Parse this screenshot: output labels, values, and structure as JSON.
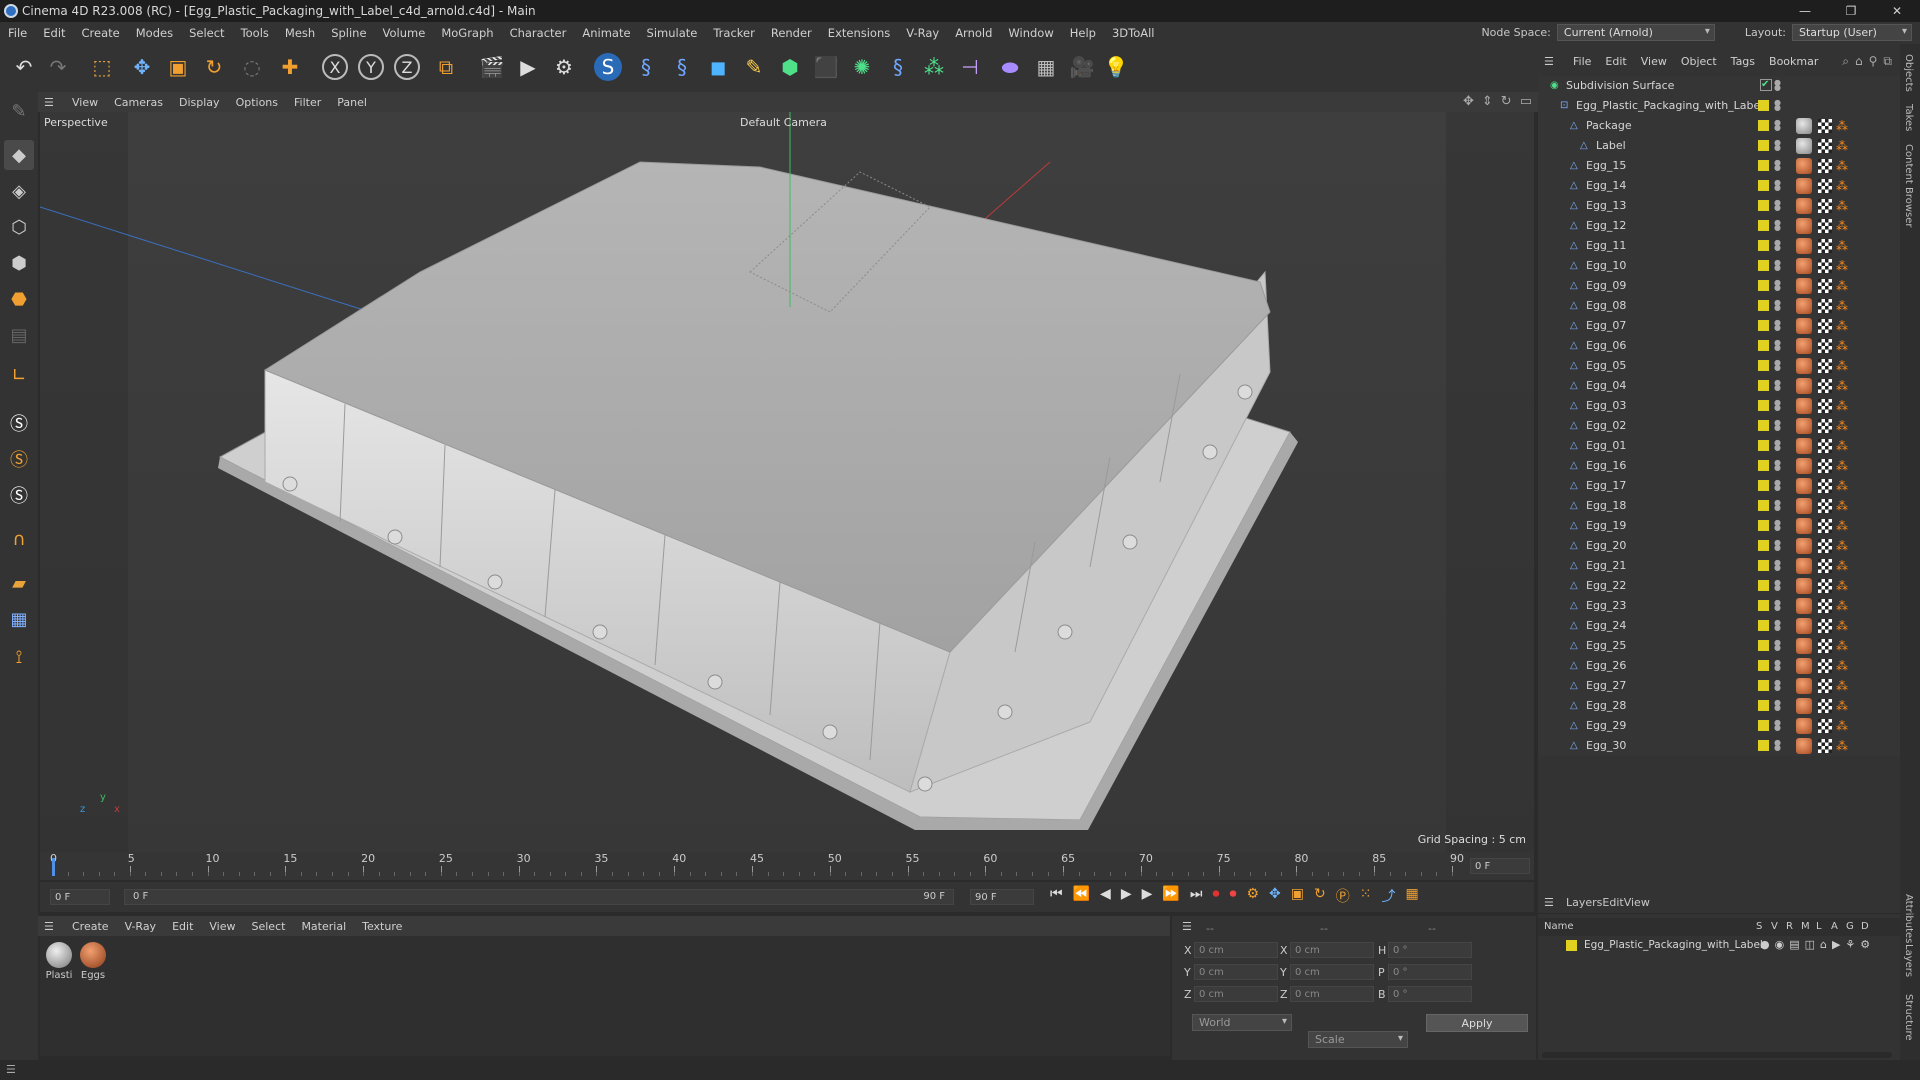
{
  "window": {
    "title": "Cinema 4D R23.008 (RC) - [Egg_Plastic_Packaging_with_Label_c4d_arnold.c4d] - Main",
    "min": "—",
    "max": "❐",
    "close": "✕"
  },
  "menubar": {
    "items": [
      "File",
      "Edit",
      "Create",
      "Modes",
      "Select",
      "Tools",
      "Mesh",
      "Spline",
      "Volume",
      "MoGraph",
      "Character",
      "Animate",
      "Simulate",
      "Tracker",
      "Render",
      "Extensions",
      "V-Ray",
      "Arnold",
      "Window",
      "Help",
      "3DToAll"
    ],
    "node_space_label": "Node Space:",
    "node_space_value": "Current (Arnold)",
    "layout_label": "Layout:",
    "layout_value": "Startup (User)"
  },
  "viewport": {
    "menu": [
      "View",
      "Cameras",
      "Display",
      "Options",
      "Filter",
      "Panel"
    ],
    "label": "Perspective",
    "camera": "Default Camera",
    "grid_spacing": "Grid Spacing : 5 cm"
  },
  "timeline": {
    "ticks": [
      "0",
      "5",
      "10",
      "15",
      "20",
      "25",
      "30",
      "35",
      "40",
      "45",
      "50",
      "55",
      "60",
      "65",
      "70",
      "75",
      "80",
      "85",
      "90"
    ],
    "end_field": "0 F"
  },
  "playback": {
    "current": "0 F",
    "range_start": "0 F",
    "range_end": "90 F",
    "max": "90 F"
  },
  "materials": {
    "menu": [
      "Create",
      "V-Ray",
      "Edit",
      "View",
      "Select",
      "Material",
      "Texture"
    ],
    "items": [
      {
        "name": "Plasti"
      },
      {
        "name": "Eggs"
      }
    ]
  },
  "coords": {
    "header1": "--",
    "header2": "--",
    "header3": "--",
    "rows": [
      {
        "a": "X",
        "av": "0 cm",
        "b": "X",
        "bv": "0 cm",
        "c": "H",
        "cv": "0 °"
      },
      {
        "a": "Y",
        "av": "0 cm",
        "b": "Y",
        "bv": "0 cm",
        "c": "P",
        "cv": "0 °"
      },
      {
        "a": "Z",
        "av": "0 cm",
        "b": "Z",
        "bv": "0 cm",
        "c": "B",
        "cv": "0 °"
      }
    ],
    "space": "World",
    "mode": "Scale",
    "apply": "Apply"
  },
  "objects": {
    "menu": [
      "File",
      "Edit",
      "View",
      "Object",
      "Tags",
      "Bookmar"
    ],
    "tree": [
      {
        "name": "Subdivision Surface",
        "indent": 0,
        "kind": "sub"
      },
      {
        "name": "Egg_Plastic_Packaging_with_Label",
        "indent": 1,
        "kind": "null"
      },
      {
        "name": "Package",
        "indent": 2,
        "kind": "obj",
        "tag": "grey"
      },
      {
        "name": "Label",
        "indent": 3,
        "kind": "obj",
        "tag": "grey"
      },
      {
        "name": "Egg_15",
        "indent": 2
      },
      {
        "name": "Egg_14",
        "indent": 2
      },
      {
        "name": "Egg_13",
        "indent": 2
      },
      {
        "name": "Egg_12",
        "indent": 2
      },
      {
        "name": "Egg_11",
        "indent": 2
      },
      {
        "name": "Egg_10",
        "indent": 2
      },
      {
        "name": "Egg_09",
        "indent": 2
      },
      {
        "name": "Egg_08",
        "indent": 2
      },
      {
        "name": "Egg_07",
        "indent": 2
      },
      {
        "name": "Egg_06",
        "indent": 2
      },
      {
        "name": "Egg_05",
        "indent": 2
      },
      {
        "name": "Egg_04",
        "indent": 2
      },
      {
        "name": "Egg_03",
        "indent": 2
      },
      {
        "name": "Egg_02",
        "indent": 2
      },
      {
        "name": "Egg_01",
        "indent": 2
      },
      {
        "name": "Egg_16",
        "indent": 2
      },
      {
        "name": "Egg_17",
        "indent": 2
      },
      {
        "name": "Egg_18",
        "indent": 2
      },
      {
        "name": "Egg_19",
        "indent": 2
      },
      {
        "name": "Egg_20",
        "indent": 2
      },
      {
        "name": "Egg_21",
        "indent": 2
      },
      {
        "name": "Egg_22",
        "indent": 2
      },
      {
        "name": "Egg_23",
        "indent": 2
      },
      {
        "name": "Egg_24",
        "indent": 2
      },
      {
        "name": "Egg_25",
        "indent": 2
      },
      {
        "name": "Egg_26",
        "indent": 2
      },
      {
        "name": "Egg_27",
        "indent": 2
      },
      {
        "name": "Egg_28",
        "indent": 2
      },
      {
        "name": "Egg_29",
        "indent": 2
      },
      {
        "name": "Egg_30",
        "indent": 2
      }
    ]
  },
  "layers": {
    "menu": [
      "Layers",
      "Edit",
      "View"
    ],
    "columns": [
      "Name",
      "S",
      "V",
      "R",
      "M",
      "L",
      "A",
      "G",
      "D"
    ],
    "rows": [
      {
        "name": "Egg_Plastic_Packaging_with_Label"
      }
    ]
  },
  "sidetabs": [
    "Objects",
    "Takes",
    "Content Browser",
    "Attributes",
    "Layers",
    "Structure"
  ],
  "colors": {
    "accent": "#4f8fe6",
    "layer": "#e0d020"
  }
}
